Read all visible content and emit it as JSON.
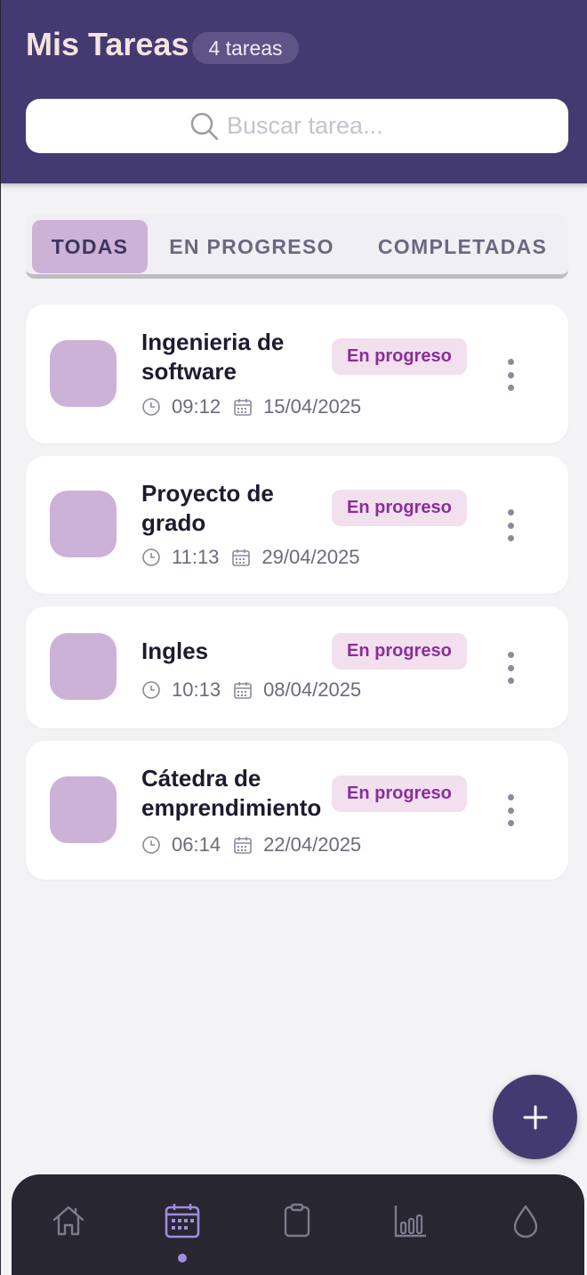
{
  "header": {
    "title": "Mis Tareas",
    "count_badge": "4 tareas"
  },
  "search": {
    "placeholder": "Buscar tarea...",
    "value": ""
  },
  "tabs": [
    {
      "label": "TODAS",
      "active": true
    },
    {
      "label": "EN PROGRESO",
      "active": false
    },
    {
      "label": "COMPLETADAS",
      "active": false
    }
  ],
  "tasks": [
    {
      "title": "Ingenieria de software",
      "status": "En progreso",
      "time": "09:12",
      "date": "15/04/2025"
    },
    {
      "title": "Proyecto de grado",
      "status": "En progreso",
      "time": "11:13",
      "date": "29/04/2025"
    },
    {
      "title": "Ingles",
      "status": "En progreso",
      "time": "10:13",
      "date": "08/04/2025"
    },
    {
      "title": "Cátedra de emprendimiento",
      "status": "En progreso",
      "time": "06:14",
      "date": "22/04/2025"
    }
  ],
  "fab": {
    "icon": "plus-icon"
  },
  "bottom_nav": [
    {
      "icon": "home-icon",
      "active": false
    },
    {
      "icon": "calendar-icon",
      "active": true
    },
    {
      "icon": "clipboard-icon",
      "active": false
    },
    {
      "icon": "bar-chart-icon",
      "active": false
    },
    {
      "icon": "drop-icon",
      "active": false
    }
  ],
  "colors": {
    "header_bg": "#443a72",
    "accent_light": "#cdb2d8",
    "status_bg": "#f3e0ef",
    "status_text": "#8a2e9b",
    "nav_bg": "#272631",
    "nav_active": "#a08ddc"
  }
}
